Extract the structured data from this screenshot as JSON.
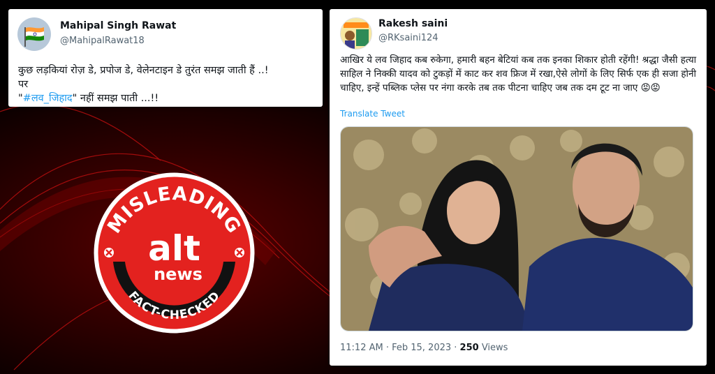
{
  "tweet1": {
    "name": "Mahipal Singh Rawat",
    "handle": "@MahipalRawat18",
    "line1": "कुछ लड़कियां रोज़ डे, प्रपोज डे, वेलेनटाइन डे तुरंत समझ जाती हैं ..!",
    "line2": "पर",
    "quote_open": "\"",
    "hashtag": "#लव_जिहाद",
    "line3_rest": "\" नहीं समझ पाती ...!!"
  },
  "tweet2": {
    "name": "Rakesh saini",
    "handle": "@RKsaini124",
    "text": "आखिर ये लव जिहाद कब रुकेगा, हमारी बहन बेटियां कब तक इनका शिकार होती रहेंगी! श्रद्धा जैसी हत्या साहिल ने निक्की यादव को टुकड़ों में काट कर शव फ्रिज में रखा,ऐसे लोगों के लिए सिर्फ एक ही सजा होनी चाहिए, इन्हें पब्लिक प्लेस पर नंगा करके तब तक पीटना चाहिए जब तक दम टूट ना जाए 😡😡",
    "translate": "Translate Tweet",
    "time": "11:12 AM · Feb 15, 2023 · ",
    "views_count": "250",
    "views_label": " Views"
  },
  "badge": {
    "top_text": "MISLEADING",
    "logo_alt": "alt",
    "logo_news": "news",
    "bottom_text": "FACT-CHECKED"
  },
  "colors": {
    "badge_red": "#e3221f",
    "link_blue": "#1d9bf0",
    "background": "#000000"
  }
}
